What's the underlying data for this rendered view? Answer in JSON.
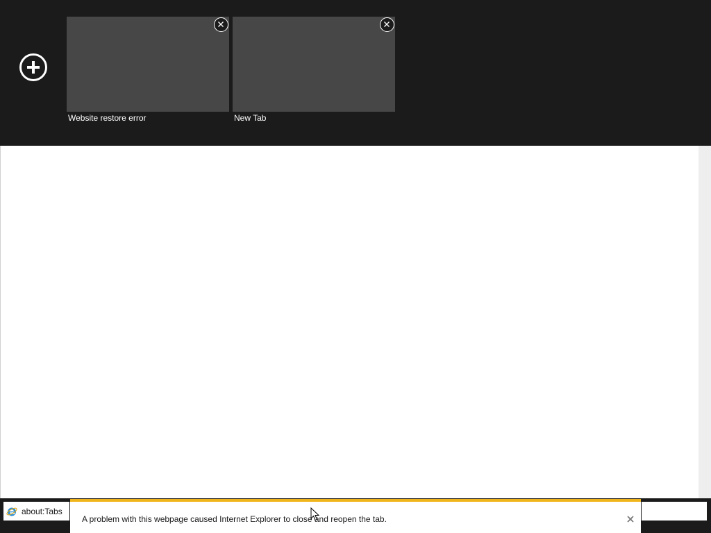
{
  "tabs": [
    {
      "title": "Website restore error"
    },
    {
      "title": "New Tab"
    }
  ],
  "address": {
    "value": "about:Tabs"
  },
  "notification": {
    "message": "A problem with this webpage caused Internet Explorer to close and reopen the tab."
  },
  "colors": {
    "tabbar_bg": "#1b1b1b",
    "tile_bg": "#474747",
    "notification_accent": "#f0b41c"
  },
  "icons": [
    "new-tab-plus-icon",
    "close-icon",
    "internet-explorer-icon"
  ]
}
